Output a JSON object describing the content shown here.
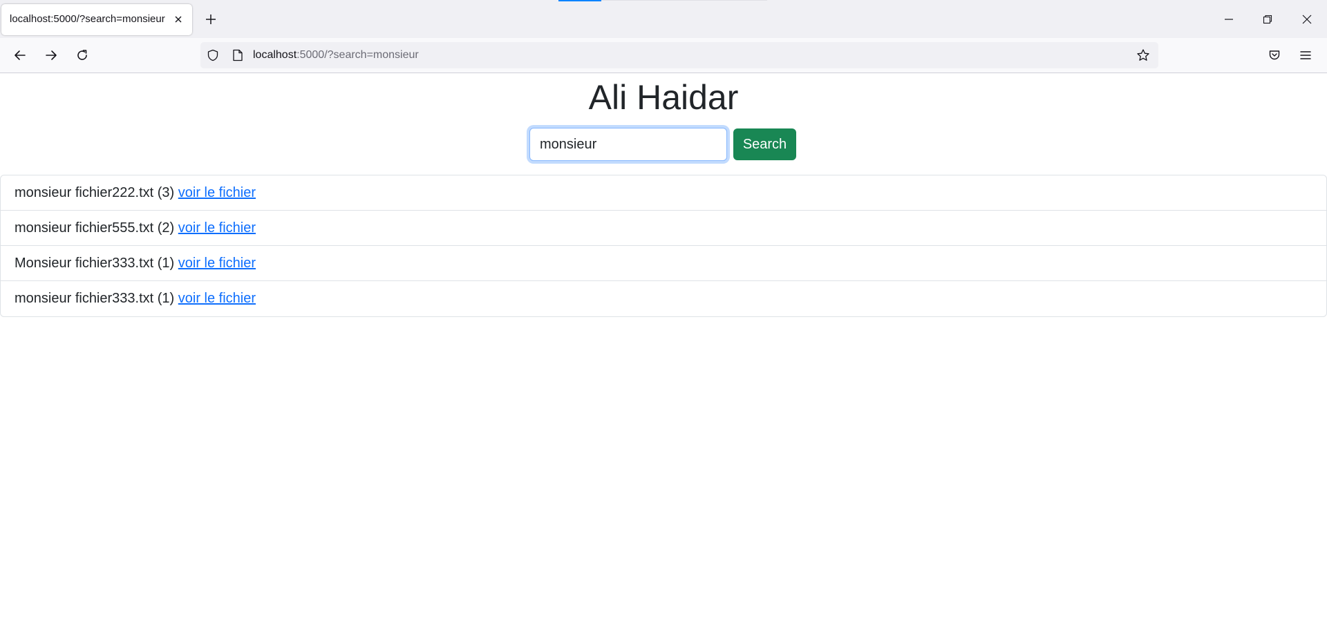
{
  "browser": {
    "tab": {
      "title": "localhost:5000/?search=monsieur"
    },
    "url": {
      "host": "localhost",
      "rest": ":5000/?search=monsieur"
    },
    "icons": {
      "tab_close": "close-icon",
      "new_tab": "plus-icon",
      "back": "arrow-left-icon",
      "forward": "arrow-right-icon",
      "reload": "reload-icon",
      "tracking": "shield-icon",
      "page": "page-icon",
      "bookmark": "star-icon",
      "pocket": "pocket-icon",
      "menu": "hamburger-menu-icon",
      "minimize": "minimize-icon",
      "restore": "restore-icon",
      "close": "close-icon"
    }
  },
  "page": {
    "title": "Ali Haidar",
    "search": {
      "value": "monsieur",
      "button_label": "Search"
    },
    "results": [
      {
        "text": "monsieur fichier222.txt (3) ",
        "link": "voir le fichier"
      },
      {
        "text": "monsieur fichier555.txt (2) ",
        "link": "voir le fichier"
      },
      {
        "text": "Monsieur fichier333.txt (1) ",
        "link": "voir le fichier"
      },
      {
        "text": "monsieur fichier333.txt (1) ",
        "link": "voir le fichier"
      }
    ]
  },
  "colors": {
    "accent_button": "#198754",
    "link": "#0d6efd",
    "focus_ring": "#86b7fe",
    "tab_indicator": "#0a84ff"
  }
}
